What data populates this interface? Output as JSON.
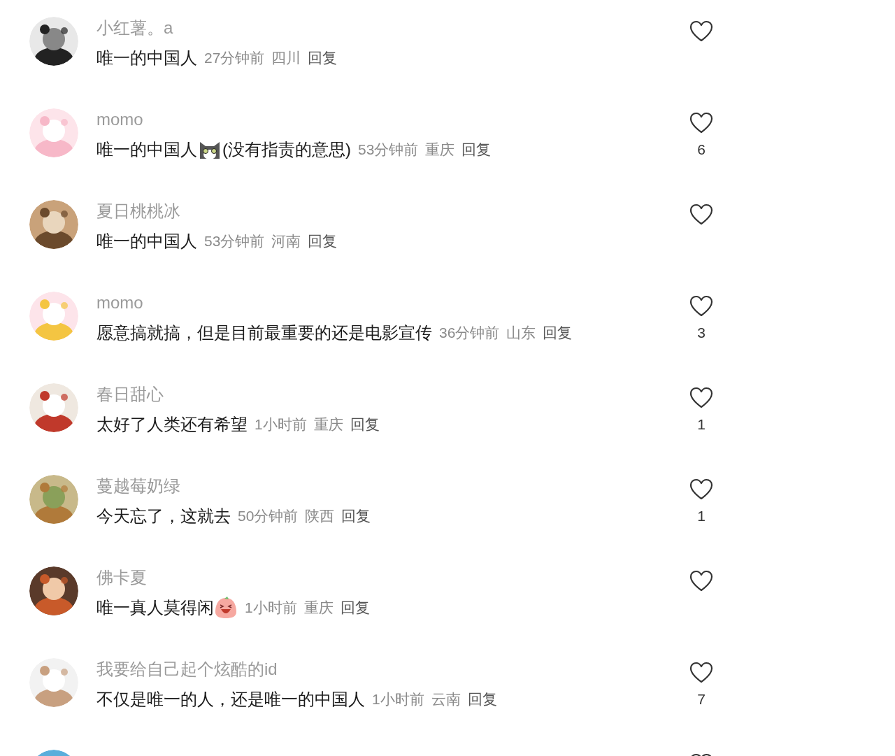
{
  "comments": [
    {
      "name": "小红薯。a",
      "segments": [
        {
          "kind": "text",
          "text": "唯一的中国人"
        }
      ],
      "time": "27分钟前",
      "location": "四川",
      "reply": "回复"
    },
    {
      "name": "momo",
      "segments": [
        {
          "kind": "text",
          "text": "唯一的中国人"
        },
        {
          "kind": "cat"
        },
        {
          "kind": "text",
          "text": "(没有指责的意思)"
        }
      ],
      "time": "53分钟前",
      "location": "重庆",
      "reply": "回复",
      "likes": "6"
    },
    {
      "name": "夏日桃桃冰",
      "segments": [
        {
          "kind": "text",
          "text": "唯一的中国人"
        }
      ],
      "time": "53分钟前",
      "location": "河南",
      "reply": "回复"
    },
    {
      "name": "momo",
      "segments": [
        {
          "kind": "text",
          "text": "愿意搞就搞，但是目前最重要的还是电影宣传"
        }
      ],
      "time": "36分钟前",
      "location": "山东",
      "reply": "回复",
      "likes": "3"
    },
    {
      "name": "春日甜心",
      "segments": [
        {
          "kind": "text",
          "text": "太好了人类还有希望"
        }
      ],
      "time": "1小时前",
      "location": "重庆",
      "reply": "回复",
      "likes": "1"
    },
    {
      "name": "蔓越莓奶绿",
      "segments": [
        {
          "kind": "text",
          "text": "今天忘了，这就去"
        }
      ],
      "time": "50分钟前",
      "location": "陕西",
      "reply": "回复",
      "likes": "1"
    },
    {
      "name": "佛卡夏",
      "segments": [
        {
          "kind": "text",
          "text": "唯一真人莫得闲"
        },
        {
          "kind": "laugh"
        }
      ],
      "time": "1小时前",
      "location": "重庆",
      "reply": "回复"
    },
    {
      "name": "我要给自己起个炫酷的id",
      "segments": [
        {
          "kind": "text",
          "text": "不仅是唯一的人，还是唯一的中国人"
        }
      ],
      "time": "1小时前",
      "location": "云南",
      "reply": "回复",
      "likes": "7"
    },
    {
      "cut_off": true
    }
  ]
}
